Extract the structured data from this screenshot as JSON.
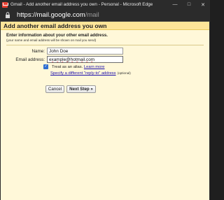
{
  "window": {
    "title": "Gmail - Add another email address you own - Personal - Microsoft Edge",
    "controls": {
      "minimize": "—",
      "maximize": "□",
      "close": "✕"
    }
  },
  "addressbar": {
    "url_host": "https://mail.google.com",
    "url_path": "/mail"
  },
  "page": {
    "heading": "Add another email address you own",
    "intro_lead": "Enter information about your other email address.",
    "intro_note": "(your name and email address will be shown on mail you send)",
    "form": {
      "name_label": "Name:",
      "name_value": "John Doe",
      "email_label": "Email address:",
      "email_value": "example@hotmail.com",
      "alias_checked": true,
      "alias_text": "Treat as an alias.",
      "learn_more": "Learn more",
      "reply_to_link": "Specify a different \"reply-to\" address",
      "optional": "(optional)"
    },
    "buttons": {
      "cancel": "Cancel",
      "next": "Next Step »"
    }
  }
}
